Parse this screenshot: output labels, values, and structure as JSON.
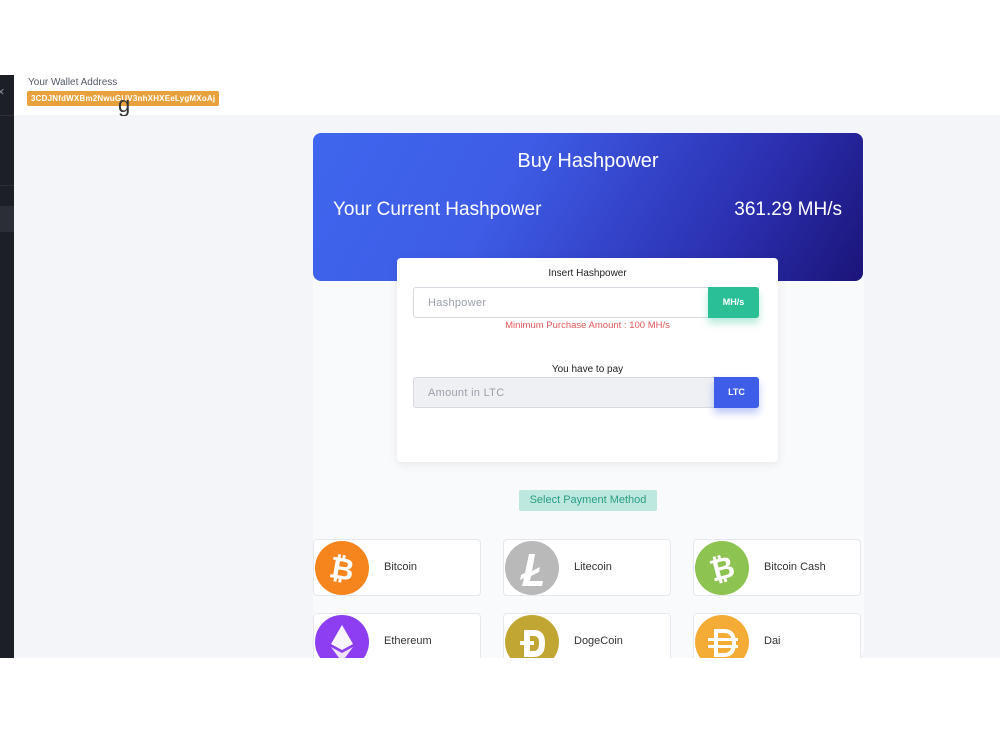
{
  "header": {
    "wallet_label": "Your Wallet Address",
    "wallet_address": "3CDJNfdWXBm2NwuGUV3nhXHXEeLygMXoAj"
  },
  "hero": {
    "title": "Buy Hashpower",
    "current_label": "Your Current Hashpower",
    "current_value": "361.29 MH/s"
  },
  "form": {
    "hashpower_label": "Insert Hashpower",
    "hashpower_placeholder": "Hashpower",
    "hashpower_unit": "MH/s",
    "min_note": "Minimum Purchase Amount : 100 MH/s",
    "pay_label": "You have to pay",
    "amount_placeholder": "Amount in LTC",
    "amount_unit": "LTC"
  },
  "payment": {
    "select_label": "Select Payment Method",
    "coins": [
      {
        "name": "Bitcoin",
        "icon": "bitcoin-icon",
        "color": "#f7851d"
      },
      {
        "name": "Litecoin",
        "icon": "litecoin-icon",
        "color": "#b9b9b9"
      },
      {
        "name": "Bitcoin Cash",
        "icon": "bitcoin-cash-icon",
        "color": "#8dc351"
      },
      {
        "name": "Ethereum",
        "icon": "ethereum-icon",
        "color": "#8c3ef0"
      },
      {
        "name": "DogeCoin",
        "icon": "dogecoin-icon",
        "color": "#c2a633"
      },
      {
        "name": "Dai",
        "icon": "dai-icon",
        "color": "#f5ac37"
      }
    ]
  },
  "colors": {
    "accent_green": "#2bbf95",
    "accent_blue": "#3e5ee9",
    "wallet_badge": "#e8a13c",
    "error_text": "#e05a5a"
  }
}
